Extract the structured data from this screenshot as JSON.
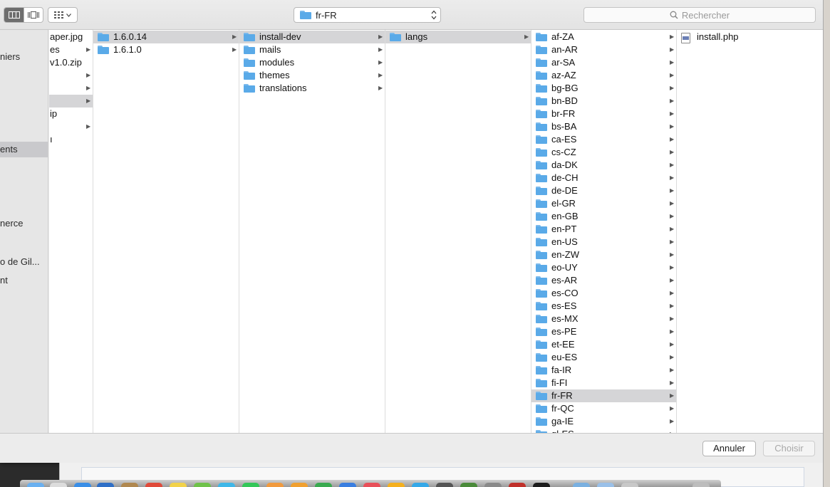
{
  "toolbar": {
    "view_modes": [
      "column-view-icon",
      "coverflow-view-icon"
    ],
    "arrange_icon": "grid-arrange-icon",
    "path_label": "fr-FR",
    "search_placeholder": "Rechercher"
  },
  "sidebar": {
    "items": [
      {
        "label": "niers",
        "selected": false
      },
      {
        "label": "ents",
        "selected": true
      },
      {
        "label": "nerce",
        "selected": false
      },
      {
        "label": "o de Gil...",
        "selected": false
      },
      {
        "label": "nt",
        "selected": false
      }
    ]
  },
  "columns": {
    "col0": {
      "rows": [
        {
          "label": "aper.jpg",
          "arrow": false,
          "selected": false
        },
        {
          "label": "es",
          "arrow": true,
          "selected": false
        },
        {
          "label": "v1.0.zip",
          "arrow": false,
          "selected": false
        },
        {
          "label": "",
          "arrow": true,
          "selected": false
        },
        {
          "label": "",
          "arrow": true,
          "selected": false
        },
        {
          "label": "",
          "arrow": true,
          "selected": true
        },
        {
          "label": "ip",
          "arrow": false,
          "selected": false
        },
        {
          "label": "",
          "arrow": true,
          "selected": false
        },
        {
          "label": "ı",
          "arrow": false,
          "selected": false
        }
      ]
    },
    "col1": {
      "rows": [
        {
          "label": "1.6.0.14",
          "selected": true
        },
        {
          "label": "1.6.1.0",
          "selected": false
        }
      ]
    },
    "col2": {
      "rows": [
        {
          "label": "install-dev",
          "selected": true
        },
        {
          "label": "mails",
          "selected": false
        },
        {
          "label": "modules",
          "selected": false
        },
        {
          "label": "themes",
          "selected": false
        },
        {
          "label": "translations",
          "selected": false
        }
      ]
    },
    "col3": {
      "rows": [
        {
          "label": "langs",
          "selected": true
        }
      ]
    },
    "col4": {
      "rows": [
        {
          "label": "af-ZA"
        },
        {
          "label": "an-AR"
        },
        {
          "label": "ar-SA"
        },
        {
          "label": "az-AZ"
        },
        {
          "label": "bg-BG"
        },
        {
          "label": "bn-BD"
        },
        {
          "label": "br-FR"
        },
        {
          "label": "bs-BA"
        },
        {
          "label": "ca-ES"
        },
        {
          "label": "cs-CZ"
        },
        {
          "label": "da-DK"
        },
        {
          "label": "de-CH"
        },
        {
          "label": "de-DE"
        },
        {
          "label": "el-GR"
        },
        {
          "label": "en-GB"
        },
        {
          "label": "en-PT"
        },
        {
          "label": "en-US"
        },
        {
          "label": "en-ZW"
        },
        {
          "label": "eo-UY"
        },
        {
          "label": "es-AR"
        },
        {
          "label": "es-CO"
        },
        {
          "label": "es-ES"
        },
        {
          "label": "es-MX"
        },
        {
          "label": "es-PE"
        },
        {
          "label": "et-EE"
        },
        {
          "label": "eu-ES"
        },
        {
          "label": "fa-IR"
        },
        {
          "label": "fi-FI"
        },
        {
          "label": "fr-FR",
          "selected": true
        },
        {
          "label": "fr-QC"
        },
        {
          "label": "ga-IE"
        },
        {
          "label": "gl-ES"
        }
      ]
    },
    "col5": {
      "rows": [
        {
          "label": "install.php",
          "icon": "php-file-icon"
        }
      ]
    }
  },
  "buttons": {
    "cancel": "Annuler",
    "choose": "Choisir"
  },
  "colors": {
    "folder": "#5aaae8",
    "selection": "#d5d5d7",
    "sidebar_selection": "#c9c9cc"
  }
}
